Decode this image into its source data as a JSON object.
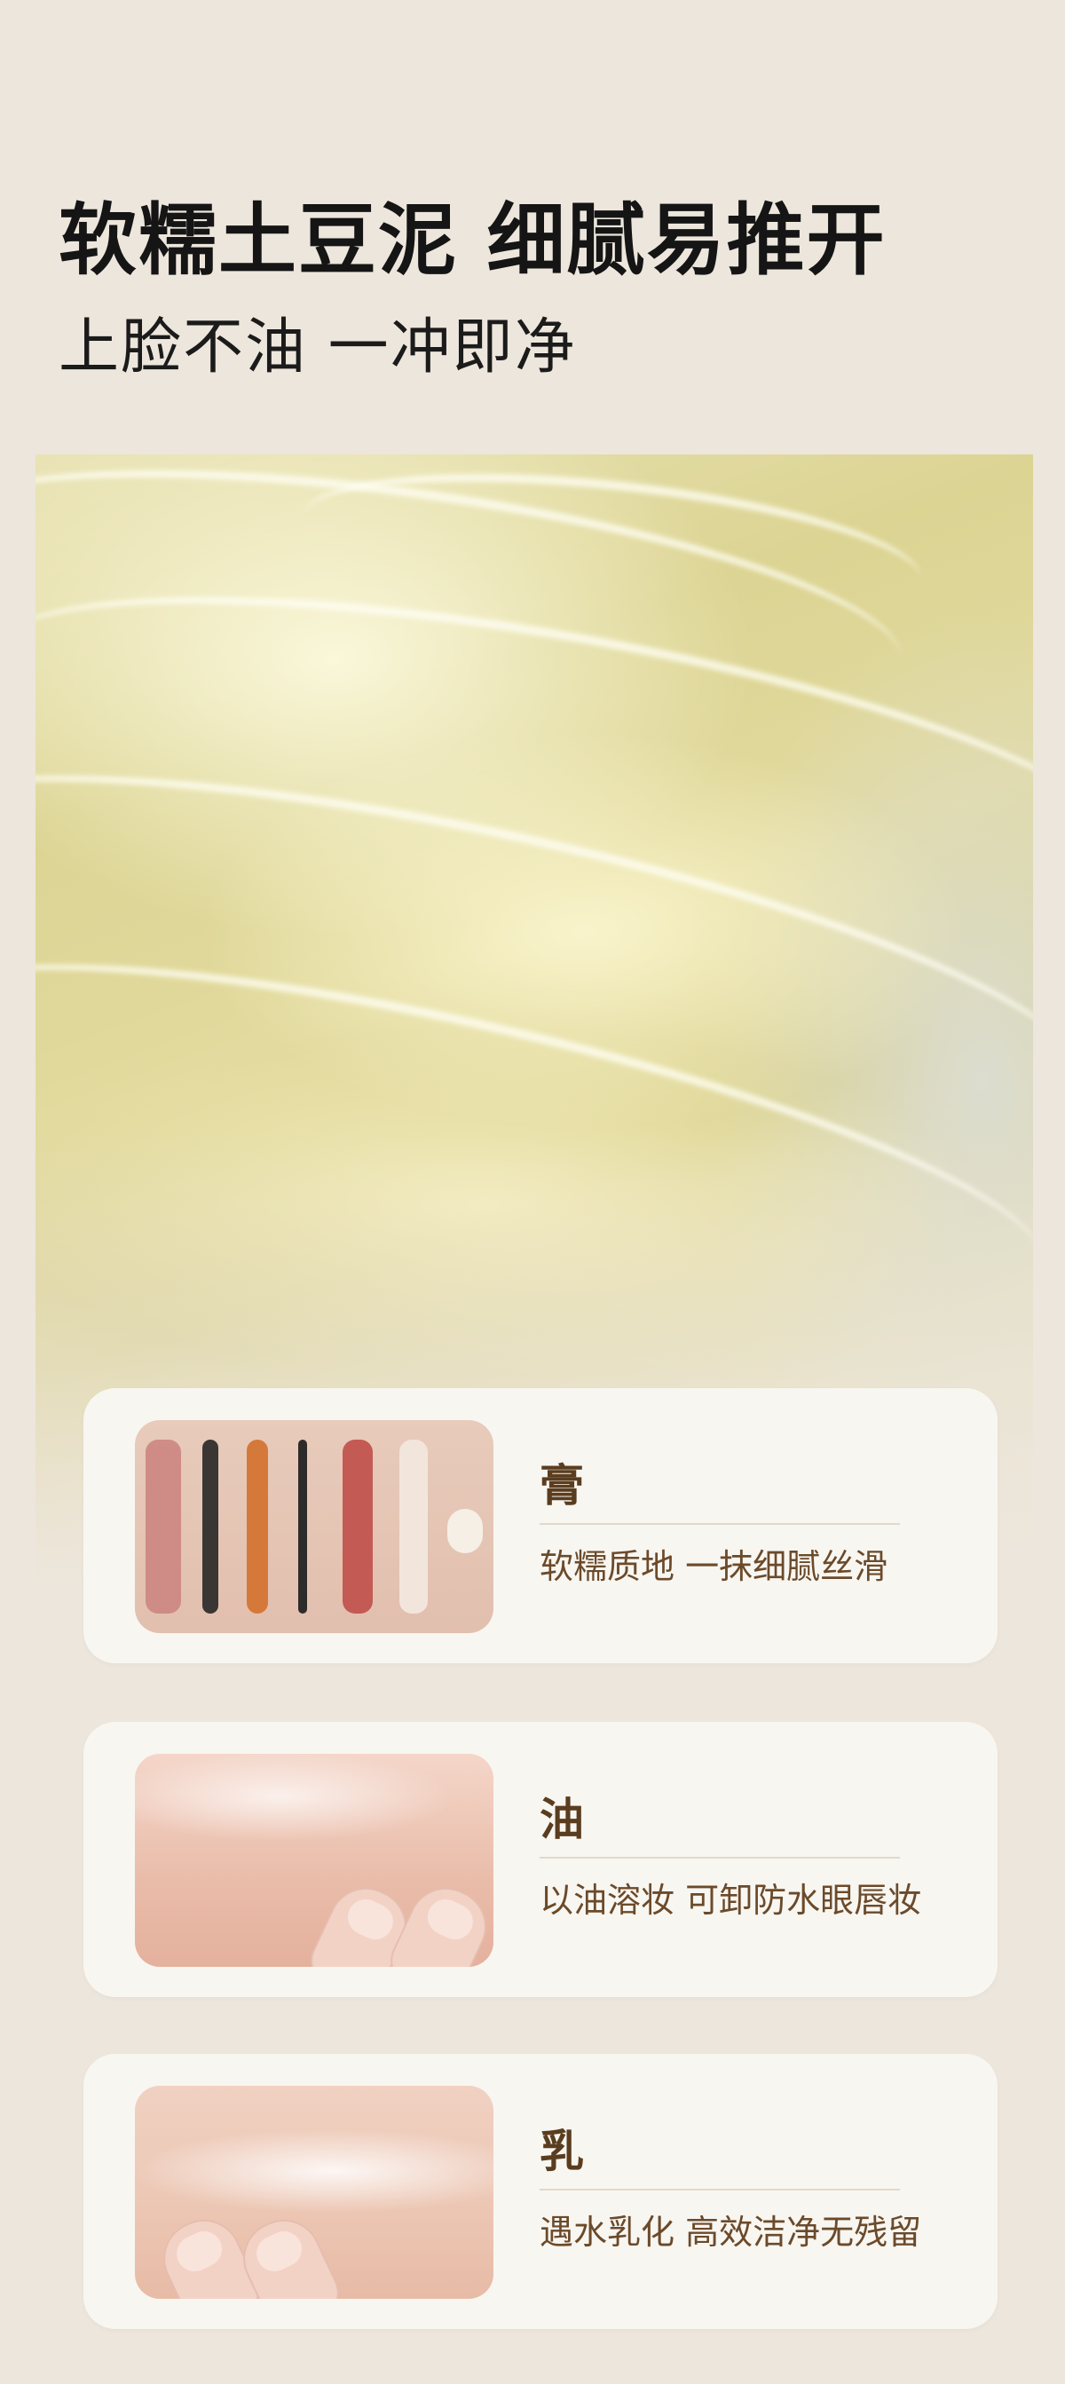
{
  "hero": {
    "headline": "软糯土豆泥 细腻易推开",
    "subheadline": "上脸不油 一冲即净"
  },
  "features": [
    {
      "title": "膏",
      "description": "软糯质地 一抹细腻丝滑"
    },
    {
      "title": "油",
      "description": "以油溶妆 可卸防水眼唇妆"
    },
    {
      "title": "乳",
      "description": "遇水乳化 高效洁净无残留"
    }
  ],
  "colors": {
    "background": "#ede6dc",
    "card": "#f8f6f1",
    "accent_text": "#5a3d1f",
    "swatches": [
      "#c97d7b",
      "#3a3633",
      "#d5793a",
      "#2e2c2b",
      "#c45a54",
      "#f2e6dc"
    ]
  }
}
